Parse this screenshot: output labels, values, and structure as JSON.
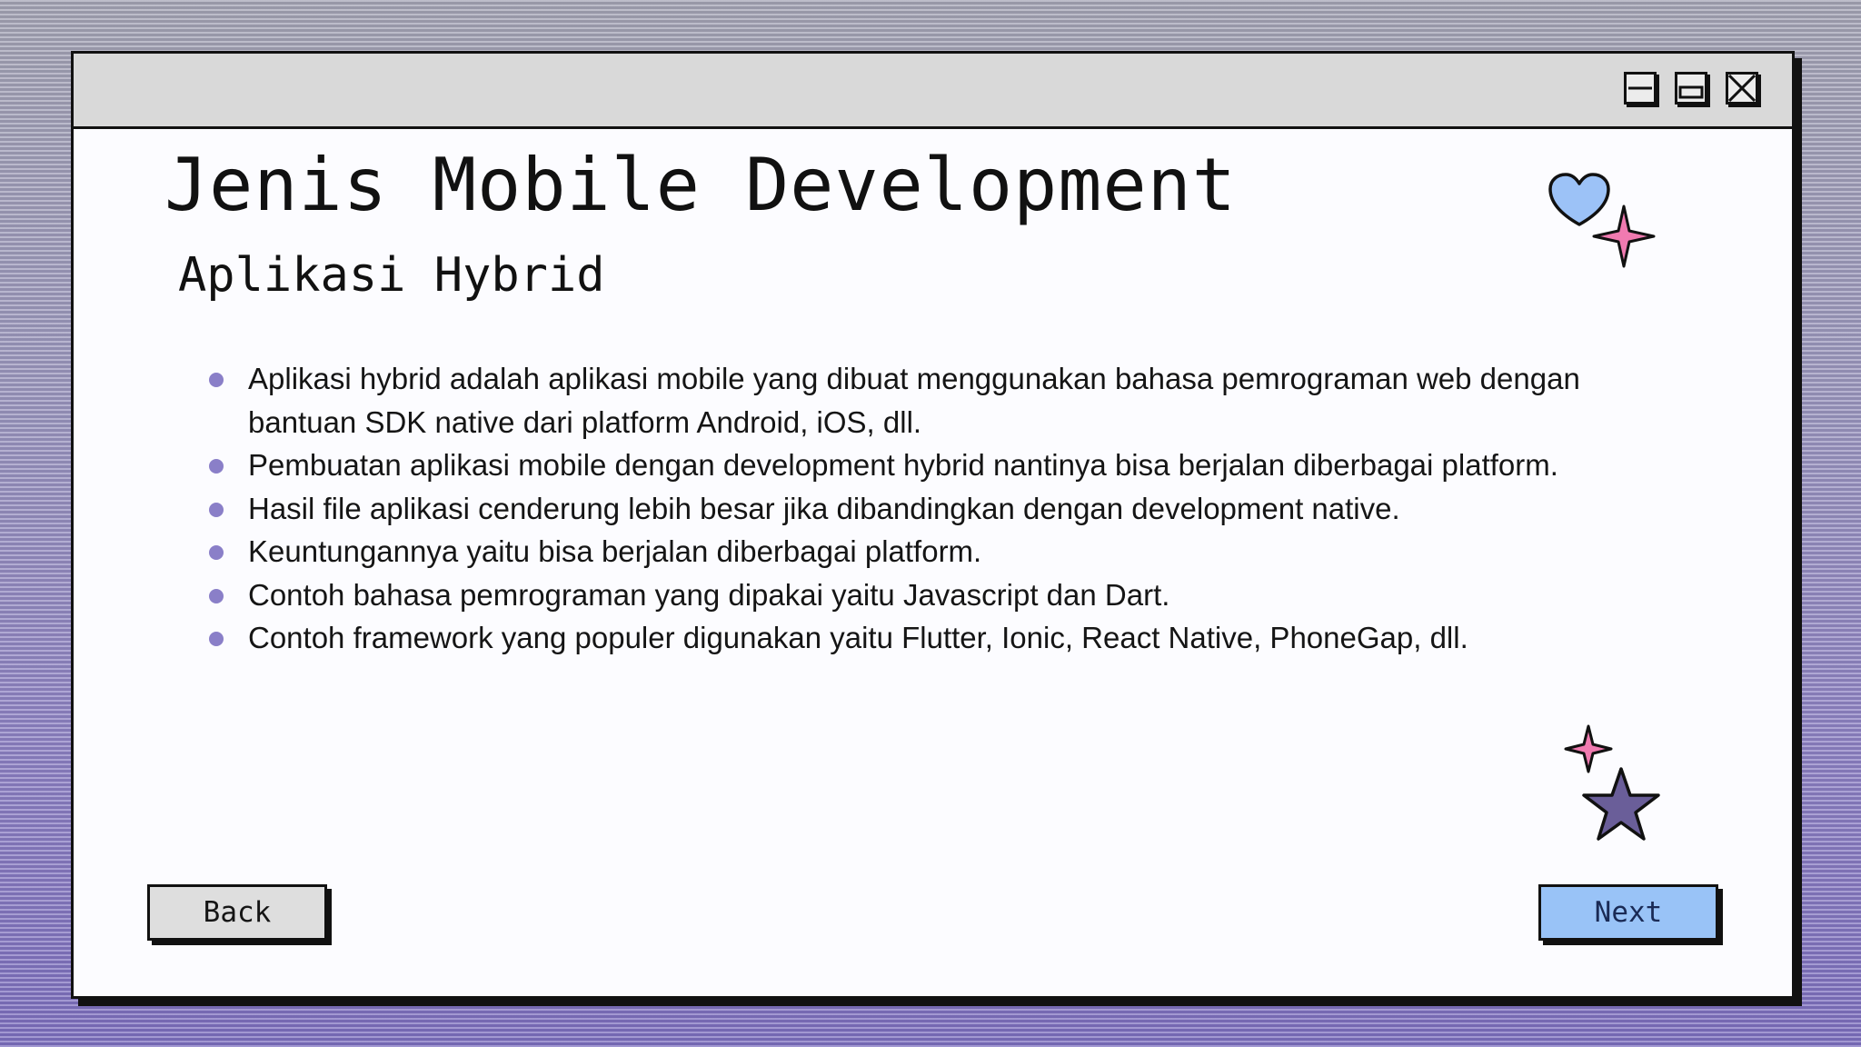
{
  "slide": {
    "title": "Jenis Mobile Development",
    "subtitle": "Aplikasi Hybrid",
    "bullets": [
      "Aplikasi hybrid adalah aplikasi mobile yang dibuat menggunakan bahasa pemrograman web dengan bantuan SDK native dari platform Android, iOS, dll.",
      "Pembuatan aplikasi mobile dengan development hybrid nantinya bisa berjalan diberbagai platform.",
      "Hasil file aplikasi cenderung lebih besar jika dibandingkan dengan development native.",
      "Keuntungannya yaitu bisa berjalan diberbagai platform.",
      "Contoh bahasa pemrograman yang dipakai yaitu Javascript dan Dart.",
      "Contoh framework yang populer digunakan yaitu Flutter, Ionic, React Native, PhoneGap, dll."
    ]
  },
  "window_controls": {
    "minimize_icon": "minimize-icon",
    "maximize_icon": "maximize-icon",
    "close_icon": "close-x-icon"
  },
  "navigation": {
    "back_label": "Back",
    "next_label": "Next"
  },
  "decorations": [
    "heart-icon",
    "sparkle-star-icon",
    "small-sparkle-icon",
    "star-icon"
  ],
  "colors": {
    "background_gradient": [
      "#a3a3b4",
      "#7d6fbf"
    ],
    "window_bg": "#fcfcff",
    "titlebar_bg": "#d9d9d9",
    "bullet_dot": "#8a7fc8",
    "back_button": "#dedede",
    "next_button": "#99c3f7",
    "heart": "#9cc2f7",
    "pink_sparkle": "#f07ab0",
    "purple_star": "#6a5e99"
  }
}
